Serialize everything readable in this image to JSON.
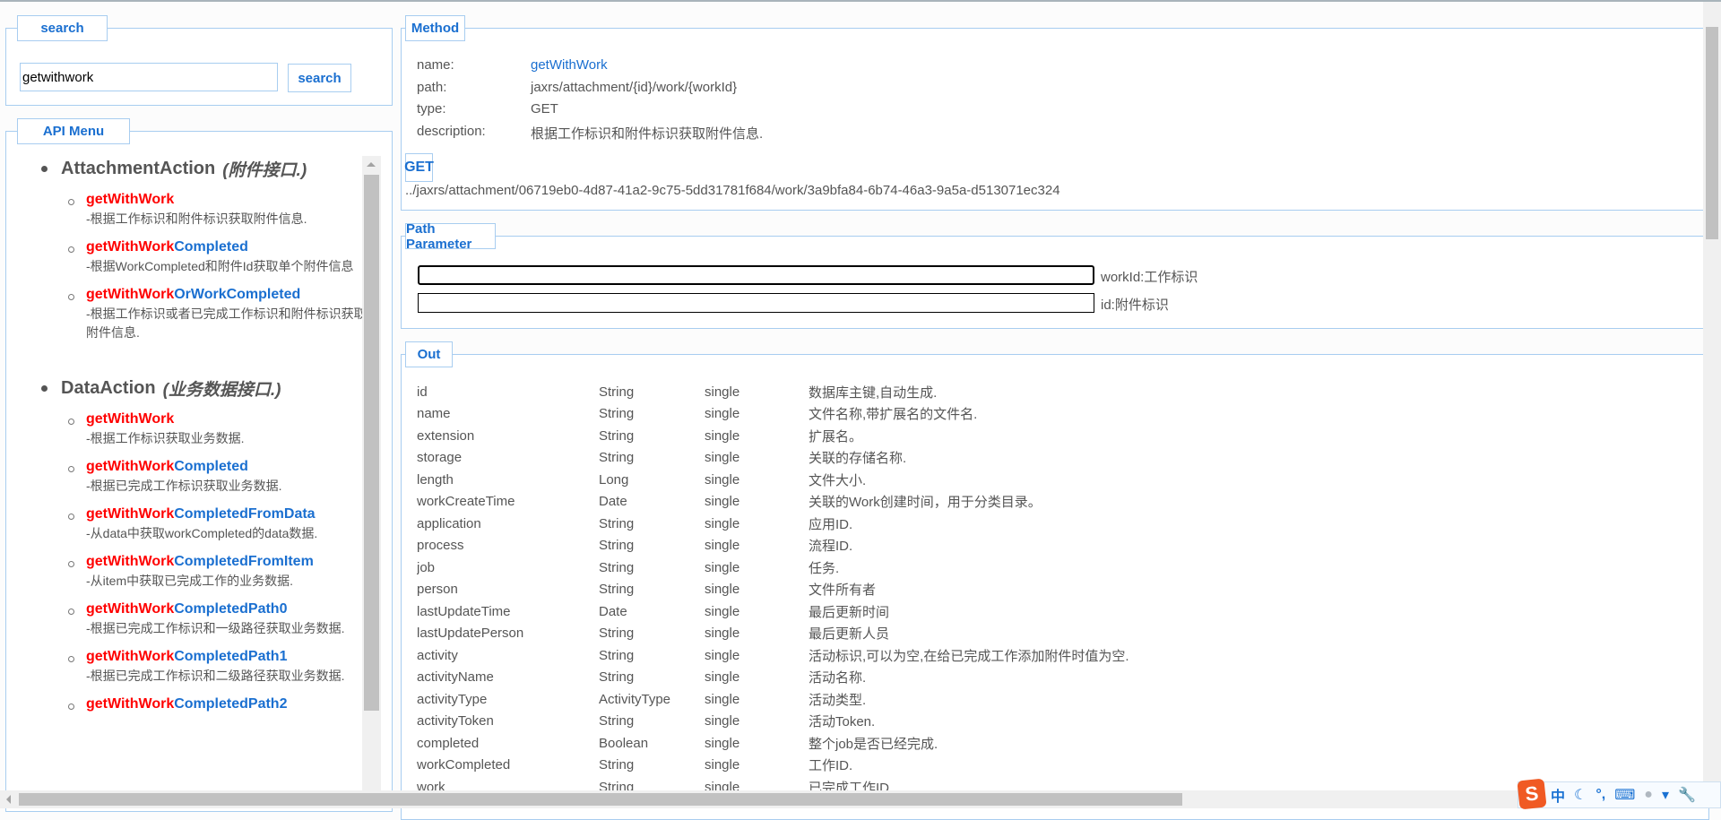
{
  "search": {
    "legend": "search",
    "value": "getwithwork",
    "button": "search"
  },
  "menu": {
    "legend": "API Menu",
    "groups": [
      {
        "name": "AttachmentAction",
        "desc": "(附件接口.)",
        "items": [
          {
            "match": "getWithWork",
            "rest": "",
            "desc": "-根据工作标识和附件标识获取附件信息."
          },
          {
            "match": "getWithWork",
            "rest": "Completed",
            "desc": "-根据WorkCompleted和附件Id获取单个附件信息"
          },
          {
            "match": "getWithWork",
            "rest": "OrWorkCompleted",
            "desc": "-根据工作标识或者已完成工作标识和附件标识获取附件信息."
          }
        ]
      },
      {
        "name": "DataAction",
        "desc": "(业务数据接口.)",
        "items": [
          {
            "match": "getWithWork",
            "rest": "",
            "desc": "-根据工作标识获取业务数据."
          },
          {
            "match": "getWithWork",
            "rest": "Completed",
            "desc": "-根据已完成工作标识获取业务数据."
          },
          {
            "match": "getWithWork",
            "rest": "CompletedFromData",
            "desc": "-从data中获取workCompleted的data数据."
          },
          {
            "match": "getWithWork",
            "rest": "CompletedFromItem",
            "desc": "-从item中获取已完成工作的业务数据."
          },
          {
            "match": "getWithWork",
            "rest": "CompletedPath0",
            "desc": "-根据已完成工作标识和一级路径获取业务数据."
          },
          {
            "match": "getWithWork",
            "rest": "CompletedPath1",
            "desc": "-根据已完成工作标识和二级路径获取业务数据."
          },
          {
            "match": "getWithWork",
            "rest": "CompletedPath2",
            "desc": ""
          }
        ]
      }
    ]
  },
  "method": {
    "legend": "Method",
    "name_label": "name:",
    "name": "getWithWork",
    "path_label": "path:",
    "path": "jaxrs/attachment/{id}/work/{workId}",
    "type_label": "type:",
    "type": "GET",
    "desc_label": "description:",
    "desc": "根据工作标识和附件标识获取附件信息.",
    "button": "GET",
    "url": "../jaxrs/attachment/06719eb0-4d87-41a2-9c75-5dd31781f684/work/3a9bfa84-6b74-46a3-9a5a-d513071ec324"
  },
  "path_params": {
    "legend": "Path Parameter",
    "params": [
      {
        "label": "workId:工作标识",
        "value": ""
      },
      {
        "label": "id:附件标识",
        "value": ""
      }
    ]
  },
  "out": {
    "legend": "Out",
    "rows": [
      [
        "id",
        "String",
        "single",
        "数据库主键,自动生成."
      ],
      [
        "name",
        "String",
        "single",
        "文件名称,带扩展名的文件名."
      ],
      [
        "extension",
        "String",
        "single",
        "扩展名。"
      ],
      [
        "storage",
        "String",
        "single",
        "关联的存储名称."
      ],
      [
        "length",
        "Long",
        "single",
        "文件大小."
      ],
      [
        "workCreateTime",
        "Date",
        "single",
        "关联的Work创建时间，用于分类目录。"
      ],
      [
        "application",
        "String",
        "single",
        "应用ID."
      ],
      [
        "process",
        "String",
        "single",
        "流程ID."
      ],
      [
        "job",
        "String",
        "single",
        "任务."
      ],
      [
        "person",
        "String",
        "single",
        "文件所有者"
      ],
      [
        "lastUpdateTime",
        "Date",
        "single",
        "最后更新时间"
      ],
      [
        "lastUpdatePerson",
        "String",
        "single",
        "最后更新人员"
      ],
      [
        "activity",
        "String",
        "single",
        "活动标识,可以为空,在给已完成工作添加附件时值为空."
      ],
      [
        "activityName",
        "String",
        "single",
        "活动名称."
      ],
      [
        "activityType",
        "ActivityType",
        "single",
        "活动类型."
      ],
      [
        "activityToken",
        "String",
        "single",
        "活动Token."
      ],
      [
        "completed",
        "Boolean",
        "single",
        "整个job是否已经完成."
      ],
      [
        "workCompleted",
        "String",
        "single",
        "工作ID."
      ],
      [
        "work",
        "String",
        "single",
        "已完成工作ID."
      ]
    ]
  },
  "ime": {
    "mode": "中",
    "logo": "S"
  },
  "colors": {
    "accent": "#1a6fd0",
    "match": "#ff0000",
    "border": "#a8cdf0"
  }
}
